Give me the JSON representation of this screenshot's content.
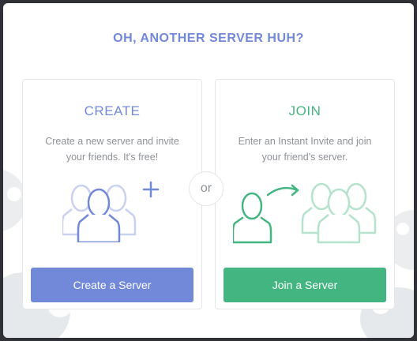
{
  "modal": {
    "title": "OH, ANOTHER SERVER HUH?",
    "separator": "or"
  },
  "create": {
    "heading": "CREATE",
    "description": "Create a new server and invite your friends. It's free!",
    "button_label": "Create a Server",
    "accent": "#7289da",
    "icon": "users-plus-icon"
  },
  "join": {
    "heading": "JOIN",
    "description": "Enter an Instant Invite and join your friend's server.",
    "button_label": "Join a Server",
    "accent": "#43b581",
    "icon": "user-arrow-group-icon"
  }
}
